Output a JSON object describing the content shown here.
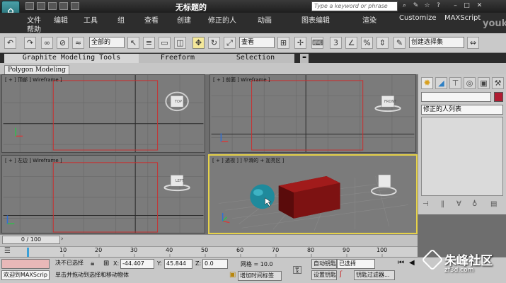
{
  "window": {
    "title": "无标题的"
  },
  "search": {
    "placeholder": "Type a keyword or phrase"
  },
  "watermark": {
    "logo_text": "youku",
    "site_text": "朱峰社区",
    "site_url": "zf3d.com"
  },
  "menu": {
    "items": [
      "文件",
      "编辑",
      "工具",
      "组",
      "查看",
      "创建",
      "修正的人",
      "动画",
      "图表编辑",
      "渲染",
      "Customize",
      "MAXScript",
      "帮助"
    ]
  },
  "toolbar": {
    "selection_filter": "全部的",
    "ref_coord": "查看",
    "named_selection": "创建选择集"
  },
  "ribbon": {
    "tabs": [
      "Graphite Modeling Tools",
      "Freeform",
      "Selection"
    ],
    "panel_tab": "Polygon Modeling"
  },
  "viewports": [
    {
      "label": "[ + ] 顶部 ] Wireframe ]",
      "cube": "TOP"
    },
    {
      "label": "[ + ] 前面 ] Wireframe ]",
      "cube": "FRONT"
    },
    {
      "label": "[ + ] 左边 ] Wireframe ]",
      "cube": "LEFT"
    },
    {
      "label": "[ + ] 透视 ]           ] 平滑的 + 加亮区 ]",
      "cube": ""
    }
  ],
  "command_panel": {
    "modifier_list": "修正的人列表"
  },
  "timeline": {
    "slider": "0 / 100",
    "ruler": [
      "10",
      "20",
      "30",
      "40",
      "50",
      "60",
      "70",
      "80",
      "90",
      "100"
    ]
  },
  "status": {
    "script_label": "欢迎到MAXScrip",
    "selection_status": "决不已选择",
    "prompt": "单击并拖动到选择和移动物体",
    "x_label": "X:",
    "x_value": "-44.407",
    "y_label": "Y:",
    "y_value": "45.844",
    "z_label": "Z:",
    "z_value": "0.0",
    "grid": "网格 = 10.0",
    "add_time_tag": "增加时间标签",
    "auto_key": "自动钥匙",
    "set_key": "设置钥匙",
    "key_mode": "已选择",
    "key_filters": "钥匙过滤器..."
  },
  "colors": {
    "box": "#8a1414",
    "sphere": "#1f8a9c",
    "active_border": "#e6d24a",
    "frame_guide": "#c83030",
    "axis_x": "#d83a3a",
    "axis_y": "#2cc14a",
    "axis_z": "#2f6fd6"
  }
}
